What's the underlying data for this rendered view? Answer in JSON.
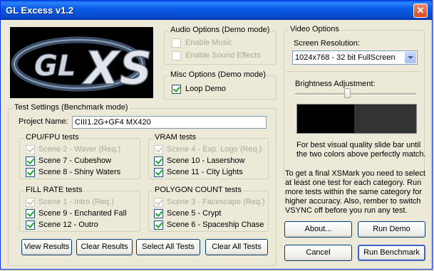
{
  "window": {
    "title": "GL Excess v1.2",
    "close_glyph": "✕"
  },
  "logo": {
    "text": "GL XS",
    "colors": {
      "bg": "#000000",
      "ring": "#5a6f8a",
      "letters": "#c8d0d8"
    }
  },
  "audio": {
    "legend": "Audio Options (Demo mode)",
    "enable_music": "Enable Music",
    "enable_sfx": "Enable Sound Effects"
  },
  "misc": {
    "legend": "Misc Options (Demo mode)",
    "loop_demo": "Loop Demo"
  },
  "video": {
    "legend": "Video Options",
    "resolution_label": "Screen Resolution:",
    "resolution_value": "1024x768 - 32 bit FullScreen",
    "brightness_label": "Brightness Adjustment:",
    "brightness_level": 0.43,
    "note": [
      "For best visual quality slide bar until",
      "the two colors above perfectly match."
    ]
  },
  "info": [
    "To get a final XSMark you need to select",
    "at least one test for each category. Run",
    "more tests within the same category for",
    "higher accuracy. Also, rember to switch",
    "VSYNC off before you run any test."
  ],
  "tests": {
    "legend": "Test Settings (Benchmark mode)",
    "project_label": "Project Name:",
    "project_value": "CIII1.2G+GF4 MX420",
    "cpu": {
      "legend": "CPU/FPU tests",
      "items": [
        "Scene 2 - Waver (Req.)",
        "Scene 7 - Cubeshow",
        "Scene 8 - Shiny Waters"
      ]
    },
    "vram": {
      "legend": "VRAM tests",
      "items": [
        "Scene 4 - Exp. Logo (Req.)",
        "Scene 10 - Lasershow",
        "Scene 11 - City Lights"
      ]
    },
    "fill": {
      "legend": "FILL RATE tests",
      "items": [
        "Scene 1 - Intro (Req.)",
        "Scene 9 - Enchanted Fall",
        "Scene 12 - Outro"
      ]
    },
    "poly": {
      "legend": "POLYGON COUNT tests",
      "items": [
        "Scene 3 - Facescape (Req.)",
        "Scene 5 - Crypt",
        "Scene 6 - Spaceship Chase"
      ]
    }
  },
  "buttons": {
    "view_results": "View Results",
    "clear_results": "Clear Results",
    "select_all": "Select All Tests",
    "clear_all": "Clear All Tests",
    "about": "About...",
    "run_demo": "Run Demo",
    "cancel": "Cancel",
    "run_benchmark": "Run Benchmark"
  }
}
